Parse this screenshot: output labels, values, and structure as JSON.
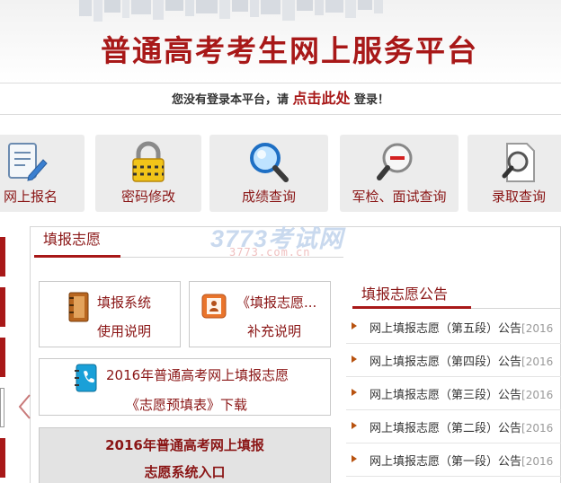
{
  "header": {
    "title": "普通高考考生网上服务平台"
  },
  "login_bar": {
    "prefix": "您没有登录本平台，请",
    "link": "点击此处",
    "suffix": "登录！"
  },
  "quick_nav": [
    {
      "label": "网上报名",
      "icon": "form-edit-icon"
    },
    {
      "label": "密码修改",
      "icon": "padlock-icon"
    },
    {
      "label": "成绩查询",
      "icon": "magnifier-icon"
    },
    {
      "label": "军检、面试查询",
      "icon": "magnifier-minus-icon"
    },
    {
      "label": "录取查询",
      "icon": "document-search-icon"
    }
  ],
  "panel": {
    "tab": "填报志愿"
  },
  "watermark": {
    "top": "3773考试网",
    "bottom": "3773.com.cn"
  },
  "buttons": {
    "system_guide": {
      "line1": "填报系统",
      "line2": "使用说明",
      "icon": "notebook-icon"
    },
    "supplement": {
      "line1": "《填报志愿...",
      "line2": "补充说明",
      "icon": "contact-card-icon"
    },
    "download": {
      "line1": "2016年普通高考网上填报志愿",
      "line2": "《志愿预填表》下载",
      "icon": "phone-book-icon"
    },
    "entry": {
      "line1": "2016年普通高考网上填报",
      "line2": "志愿系统入口"
    }
  },
  "notices": {
    "title": "填报志愿公告",
    "items": [
      {
        "text": "网上填报志愿（第五段）公告",
        "date": "[2016"
      },
      {
        "text": "网上填报志愿（第四段）公告",
        "date": "[2016"
      },
      {
        "text": "网上填报志愿（第三段）公告",
        "date": "[2016"
      },
      {
        "text": "网上填报志愿（第二段）公告",
        "date": "[2016"
      },
      {
        "text": "网上填报志愿（第一段）公告",
        "date": "[2016"
      }
    ]
  },
  "colors": {
    "brand_red": "#a81818",
    "label_red": "#8a1515",
    "tile_bg": "#ececec",
    "arrow_orange": "#b8520f"
  }
}
